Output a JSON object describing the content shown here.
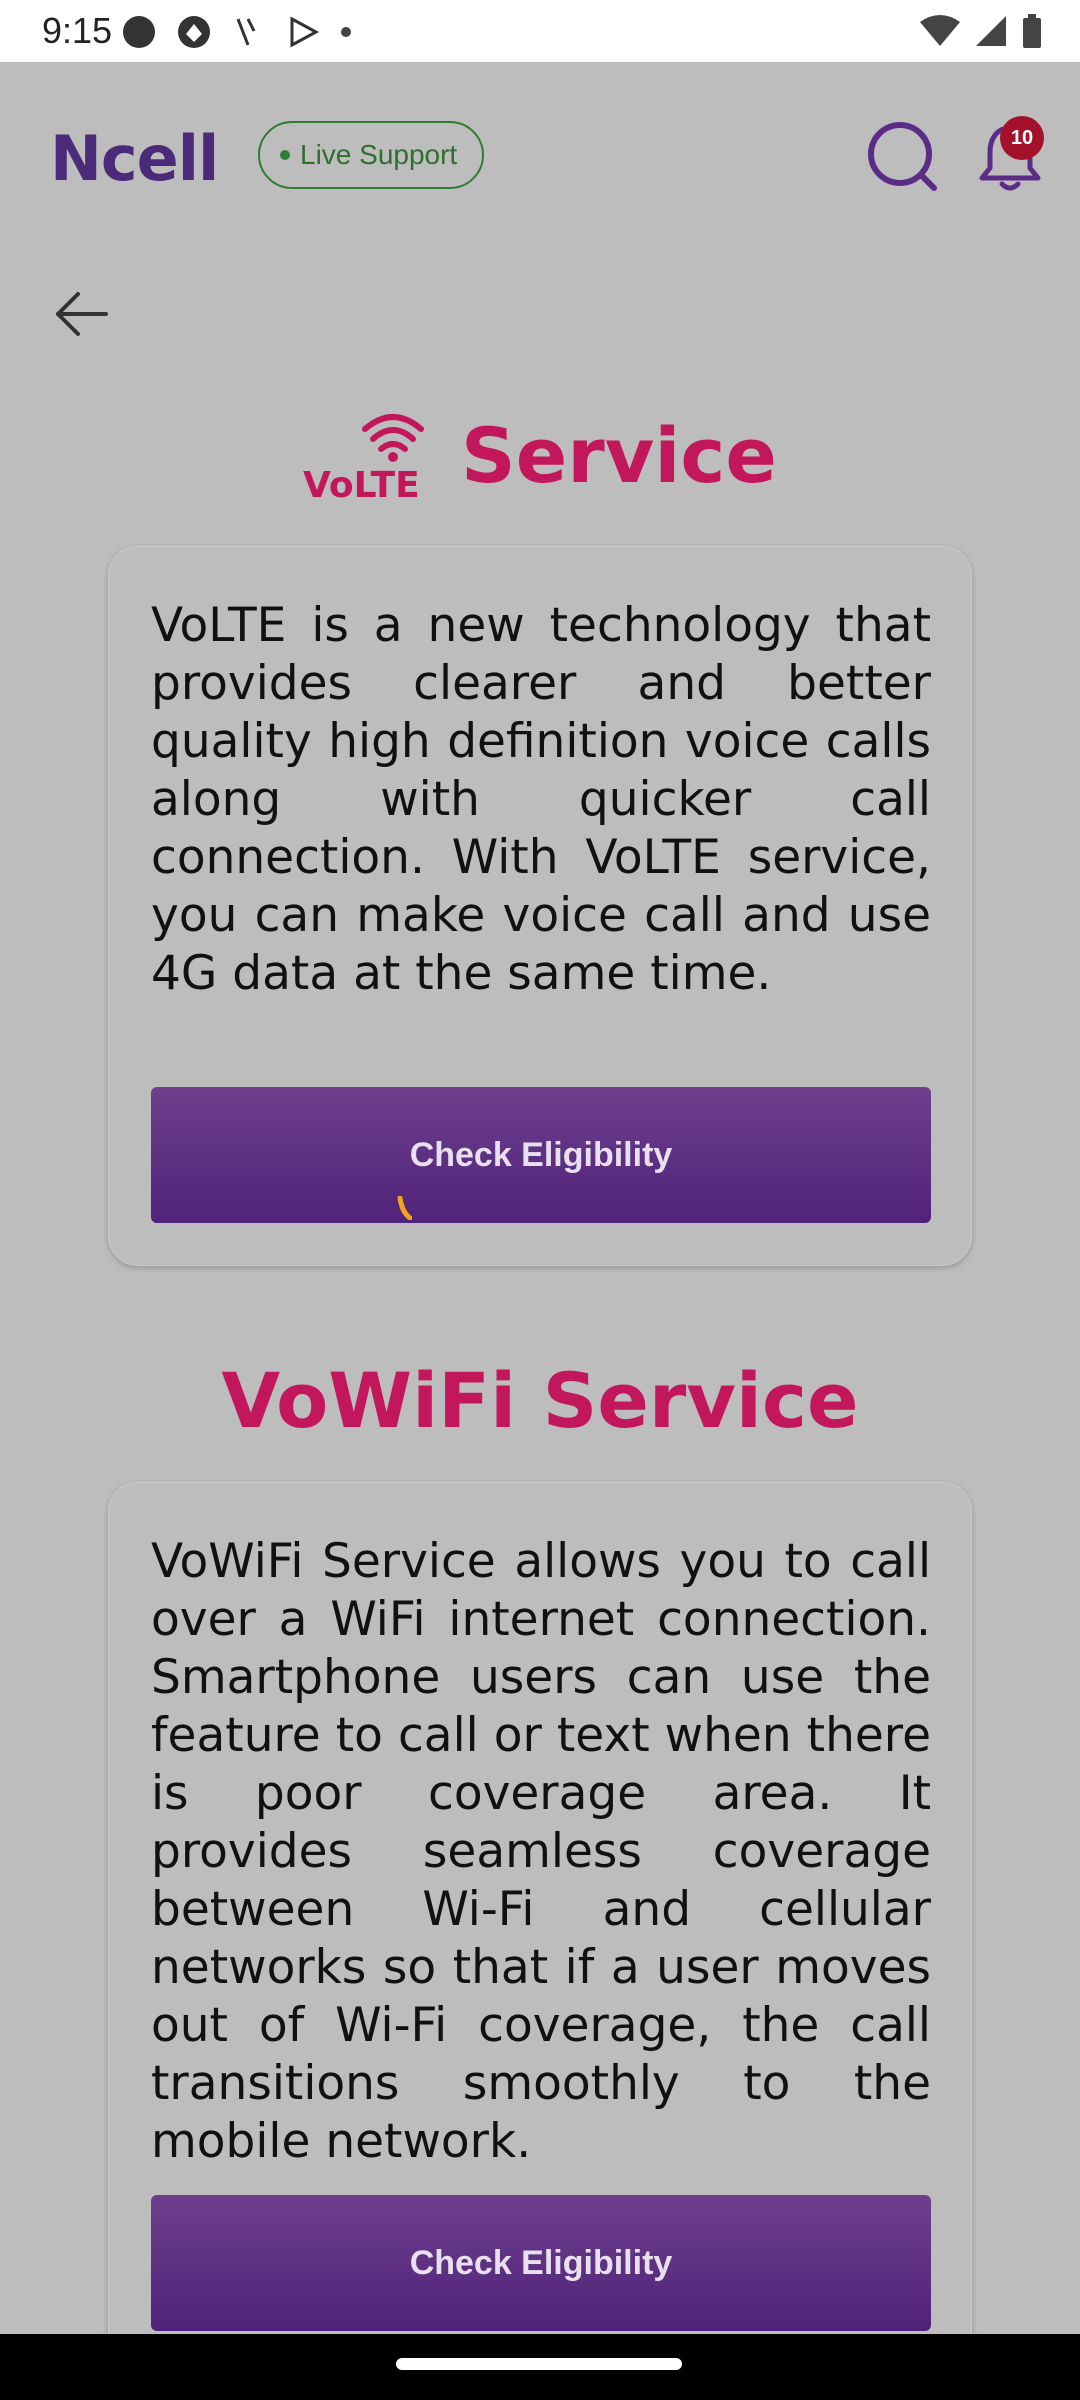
{
  "status_bar": {
    "time": "9:15",
    "left_icons": [
      "record-icon",
      "browser-icon",
      "app-icon",
      "play-store-icon",
      "dot-icon"
    ],
    "right_icons": [
      "wifi-icon",
      "signal-icon",
      "battery-icon"
    ]
  },
  "header": {
    "logo": "Ncell",
    "live_support_label": "Live Support",
    "notification_count": "10",
    "accent_color": "#4b2a79"
  },
  "volte": {
    "logo_text": "VoLTE",
    "title": "Service",
    "description": "VoLTE is a new technology that provides clearer and better quality high definition voice calls along with quicker call connection. With VoLTE service, you can make voice call and use 4G data at the same time.",
    "button_label": "Check Eligibility"
  },
  "vowifi": {
    "title": "VoWiFi Service",
    "description": "VoWiFi Service allows you to call over a WiFi internet connection. Smartphone users can use the feature to call or text when there is poor coverage area. It provides seamless coverage between Wi-Fi and cellular networks so that if a user moves out of Wi-Fi coverage, the call transitions smoothly to the mobile network.",
    "button_label": "Check Eligibility"
  },
  "colors": {
    "title": "#c2185b",
    "button": "#5a2d82",
    "badge": "#a3122a",
    "live_support": "#2e7d32"
  }
}
